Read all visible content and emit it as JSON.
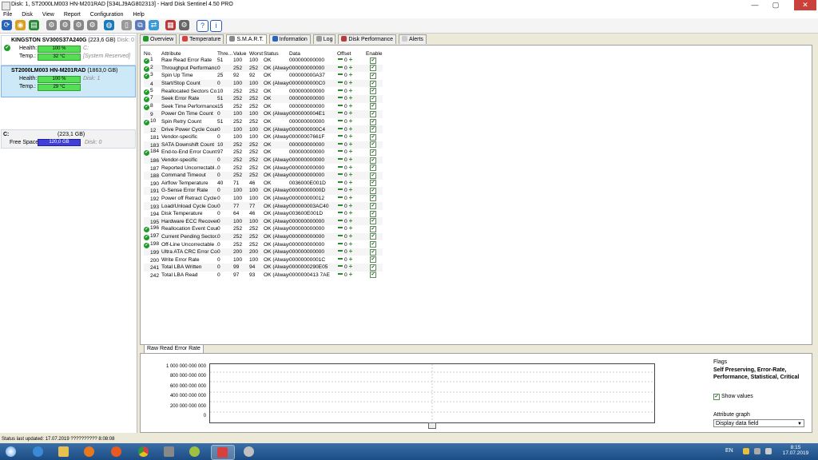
{
  "window": {
    "title": "Disk: 1, ST2000LM003 HN-M201RAD [S34LJ9AG802313]  -  Hard Disk Sentinel 4.50 PRO",
    "controls": [
      "—",
      "▢",
      "✕"
    ]
  },
  "menu": [
    "File",
    "Disk",
    "View",
    "Report",
    "Configuration",
    "Help"
  ],
  "left_panel": {
    "disks": [
      {
        "name": "KINGSTON SV300S37A240G",
        "size": "(223,6 GB)",
        "disk_label": "Disk: 0",
        "health": "100 %",
        "health_ext": "C:",
        "temp": "32 °C",
        "temp_ext": "[System Reserved]"
      },
      {
        "name": "ST2000LM003 HN-M201RAD",
        "size": "(1863,0 GB)",
        "disk_label": "Disk: 1",
        "health": "100 %",
        "health_ext": "",
        "temp": "29 °C",
        "temp_ext": ""
      }
    ],
    "labels": {
      "health": "Health:",
      "temp": "Temp.:"
    },
    "volume": {
      "name": "C:",
      "size": "(223,1 GB)",
      "free_label": "Free Space",
      "free_value": "120,0 GB",
      "disk_label": "Disk: 0"
    }
  },
  "tabs": [
    "Overview",
    "Temperature",
    "S.M.A.R.T.",
    "Information",
    "Log",
    "Disk Performance",
    "Alerts"
  ],
  "smart": {
    "headers": [
      "No.",
      "Attribute",
      "Thre...",
      "Value",
      "Worst",
      "Status",
      "Data",
      "Offset",
      "Enable"
    ],
    "rows": [
      {
        "ok": true,
        "no": "1",
        "attr": "Raw Read Error Rate",
        "thr": "51",
        "val": "100",
        "wor": "100",
        "st": "OK",
        "data": "000000000000"
      },
      {
        "ok": true,
        "no": "2",
        "attr": "Throughput Performance",
        "thr": "0",
        "val": "252",
        "wor": "252",
        "st": "OK (Always...",
        "data": "000000000000"
      },
      {
        "ok": true,
        "no": "3",
        "attr": "Spin Up Time",
        "thr": "25",
        "val": "92",
        "wor": "92",
        "st": "OK",
        "data": "000000000A37"
      },
      {
        "ok": false,
        "no": "4",
        "attr": "Start/Stop Count",
        "thr": "0",
        "val": "100",
        "wor": "100",
        "st": "OK (Always...",
        "data": "0000000000C0"
      },
      {
        "ok": true,
        "no": "5",
        "attr": "Reallocated Sectors Co...",
        "thr": "10",
        "val": "252",
        "wor": "252",
        "st": "OK",
        "data": "000000000000"
      },
      {
        "ok": true,
        "no": "7",
        "attr": "Seek Error Rate",
        "thr": "51",
        "val": "252",
        "wor": "252",
        "st": "OK",
        "data": "000000000000"
      },
      {
        "ok": true,
        "no": "8",
        "attr": "Seek Time Performance",
        "thr": "15",
        "val": "252",
        "wor": "252",
        "st": "OK",
        "data": "000000000000"
      },
      {
        "ok": false,
        "no": "9",
        "attr": "Power On Time Count",
        "thr": "0",
        "val": "100",
        "wor": "100",
        "st": "OK (Always...",
        "data": "0000000004E1"
      },
      {
        "ok": true,
        "no": "10",
        "attr": "Spin Retry Count",
        "thr": "51",
        "val": "252",
        "wor": "252",
        "st": "OK",
        "data": "000000000000"
      },
      {
        "ok": false,
        "no": "12",
        "attr": "Drive Power Cycle Count",
        "thr": "0",
        "val": "100",
        "wor": "100",
        "st": "OK (Always...",
        "data": "0000000000C4"
      },
      {
        "ok": false,
        "no": "181",
        "attr": "Vendor-specific",
        "thr": "0",
        "val": "100",
        "wor": "100",
        "st": "OK (Always...",
        "data": "00000007661F"
      },
      {
        "ok": false,
        "no": "183",
        "attr": "SATA Downshift Count",
        "thr": "10",
        "val": "252",
        "wor": "252",
        "st": "OK",
        "data": "000000000000"
      },
      {
        "ok": true,
        "no": "184",
        "attr": "End-to-End Error Count",
        "thr": "97",
        "val": "252",
        "wor": "252",
        "st": "OK",
        "data": "000000000000"
      },
      {
        "ok": false,
        "no": "186",
        "attr": "Vendor-specific",
        "thr": "0",
        "val": "252",
        "wor": "252",
        "st": "OK (Always...",
        "data": "000000000000"
      },
      {
        "ok": false,
        "no": "187",
        "attr": "Reported Uncorrectabl...",
        "thr": "0",
        "val": "252",
        "wor": "252",
        "st": "OK (Always...",
        "data": "000000000000"
      },
      {
        "ok": false,
        "no": "188",
        "attr": "Command Timeout",
        "thr": "0",
        "val": "252",
        "wor": "252",
        "st": "OK (Always...",
        "data": "000000000000"
      },
      {
        "ok": false,
        "no": "190",
        "attr": "Airflow Temperature",
        "thr": "40",
        "val": "71",
        "wor": "46",
        "st": "OK",
        "data": "0036000E001D"
      },
      {
        "ok": false,
        "no": "191",
        "attr": "G-Sense Error Rate",
        "thr": "0",
        "val": "100",
        "wor": "100",
        "st": "OK (Always...",
        "data": "00000000000D"
      },
      {
        "ok": false,
        "no": "192",
        "attr": "Power off Retract Cycle ...",
        "thr": "0",
        "val": "100",
        "wor": "100",
        "st": "OK (Always...",
        "data": "000000000012"
      },
      {
        "ok": false,
        "no": "193",
        "attr": "Load/Unload Cycle Cou...",
        "thr": "0",
        "val": "77",
        "wor": "77",
        "st": "OK (Always...",
        "data": "000000003AC40"
      },
      {
        "ok": false,
        "no": "194",
        "attr": "Disk Temperature",
        "thr": "0",
        "val": "64",
        "wor": "46",
        "st": "OK (Always...",
        "data": "003600E001D"
      },
      {
        "ok": false,
        "no": "195",
        "attr": "Hardware ECC Recovered",
        "thr": "0",
        "val": "100",
        "wor": "100",
        "st": "OK (Always...",
        "data": "000000000000"
      },
      {
        "ok": true,
        "no": "196",
        "attr": "Reallocation Event Count",
        "thr": "0",
        "val": "252",
        "wor": "252",
        "st": "OK (Always...",
        "data": "000000000000"
      },
      {
        "ok": true,
        "no": "197",
        "attr": "Current Pending Sector...",
        "thr": "0",
        "val": "252",
        "wor": "252",
        "st": "OK (Always...",
        "data": "000000000000"
      },
      {
        "ok": true,
        "no": "198",
        "attr": "Off-Line Uncorrectable ...",
        "thr": "0",
        "val": "252",
        "wor": "252",
        "st": "OK (Always...",
        "data": "000000000000"
      },
      {
        "ok": false,
        "no": "199",
        "attr": "Ultra ATA CRC Error Co...",
        "thr": "0",
        "val": "200",
        "wor": "200",
        "st": "OK (Always...",
        "data": "000000000000"
      },
      {
        "ok": false,
        "no": "200",
        "attr": "Write Error Rate",
        "thr": "0",
        "val": "100",
        "wor": "100",
        "st": "OK (Always...",
        "data": "00000000001C"
      },
      {
        "ok": false,
        "no": "241",
        "attr": "Total LBA Written",
        "thr": "0",
        "val": "99",
        "wor": "94",
        "st": "OK (Always...",
        "data": "0000000290E05"
      },
      {
        "ok": false,
        "no": "242",
        "attr": "Total LBA Read",
        "thr": "0",
        "val": "97",
        "wor": "93",
        "st": "OK (Always...",
        "data": "0000000413 7AE"
      }
    ],
    "offset_value": "0"
  },
  "graph": {
    "tab": "Raw Read Error Rate",
    "yticks": [
      "1 000 000 000 000",
      "800 000 000 000",
      "600 000 000 000",
      "400 000 000 000",
      "200 000 000 000",
      "0"
    ]
  },
  "flags": {
    "title": "Flags",
    "text": "Self Preserving, Error-Rate, Performance, Statistical, Critical",
    "show_values": "Show values",
    "attr_graph": "Attribute graph",
    "select_value": "Display data field"
  },
  "status": {
    "text": "Status last updated: 17.07.2019 ?????????? 8:08:08"
  },
  "tray": {
    "lang": "EN",
    "time": "8:15",
    "date": "17.07.2019"
  },
  "colors": {
    "health_bar": "#55dd55",
    "free_bar": "#4040d8",
    "ok_icon": "#1e9a2a"
  }
}
